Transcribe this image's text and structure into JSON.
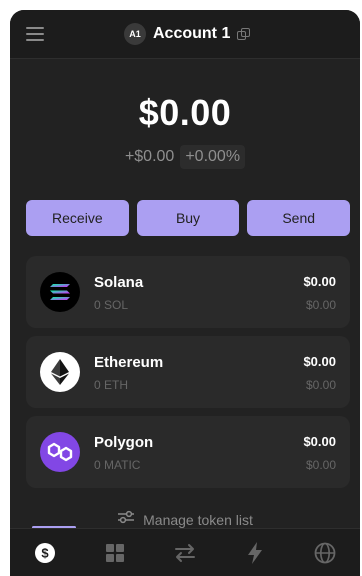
{
  "header": {
    "account_badge": "A1",
    "account_name": "Account 1"
  },
  "balance": {
    "total": "$0.00",
    "change_usd": "+$0.00",
    "change_pct": "+0.00%"
  },
  "actions": {
    "receive": "Receive",
    "buy": "Buy",
    "send": "Send"
  },
  "tokens": [
    {
      "name": "Solana",
      "amount": "0 SOL",
      "usd": "$0.00",
      "usd_secondary": "$0.00",
      "icon": "solana-icon"
    },
    {
      "name": "Ethereum",
      "amount": "0 ETH",
      "usd": "$0.00",
      "usd_secondary": "$0.00",
      "icon": "ethereum-icon"
    },
    {
      "name": "Polygon",
      "amount": "0 MATIC",
      "usd": "$0.00",
      "usd_secondary": "$0.00",
      "icon": "polygon-icon"
    }
  ],
  "manage": {
    "label": "Manage token list",
    "icon": "sliders-icon"
  },
  "nav": {
    "items": [
      "dollar-icon",
      "grid-icon",
      "swap-icon",
      "lightning-icon",
      "globe-icon"
    ],
    "active": "dollar-icon"
  },
  "colors": {
    "accent": "#ab9ff2",
    "background": "#222222",
    "card": "#2a2a2a"
  }
}
